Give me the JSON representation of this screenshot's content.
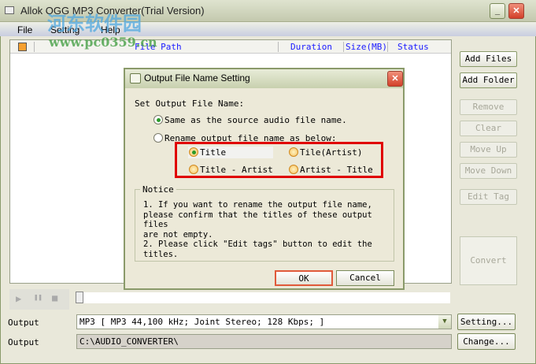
{
  "window": {
    "title": "Allok OGG MP3 Converter(Trial Version)",
    "minimize": "_",
    "close": "✕"
  },
  "menu": [
    "File",
    "Setting",
    "Help"
  ],
  "watermark": {
    "name": "河东软件园",
    "url": "www.pc0359.cn"
  },
  "list": {
    "columns": [
      "File Path",
      "Duration",
      "Size(MB)",
      "Status"
    ]
  },
  "side_buttons": [
    {
      "label": "Add Files",
      "enabled": true
    },
    {
      "label": "Add Folder",
      "enabled": true
    },
    {
      "label": "Remove",
      "enabled": false
    },
    {
      "label": "Clear",
      "enabled": false
    },
    {
      "label": "Move Up",
      "enabled": false
    },
    {
      "label": "Move Down",
      "enabled": false
    },
    {
      "label": "Edit Tag",
      "enabled": false
    }
  ],
  "convert": "Convert",
  "player": {
    "play": "▶",
    "pause": "❚❚",
    "stop": "■",
    "position": 0
  },
  "output": {
    "format_label": "Output",
    "format_value": "MP3 [ MP3 44,100 kHz; Joint Stereo;  128 Kbps;  ]",
    "setting_button": "Setting...",
    "folder_label": "Output",
    "folder_value": "C:\\AUDIO_CONVERTER\\",
    "change_button": "Change..."
  },
  "dialog": {
    "title": "Output File Name Setting",
    "heading": "Set Output File Name:",
    "option_same": "Same as the source audio file name.",
    "option_rename": "Rename output file name as below:",
    "formats": [
      "Title",
      "Tile(Artist)",
      "Title - Artist",
      "Artist - Title"
    ],
    "notice_title": "Notice",
    "notice_lines": [
      "1. If you want to rename the output file name,",
      "please confirm that the titles of these output files",
      "are not empty.",
      "2. Please click \"Edit tags\" button to edit the",
      "titles."
    ],
    "ok": "OK",
    "cancel": "Cancel"
  }
}
